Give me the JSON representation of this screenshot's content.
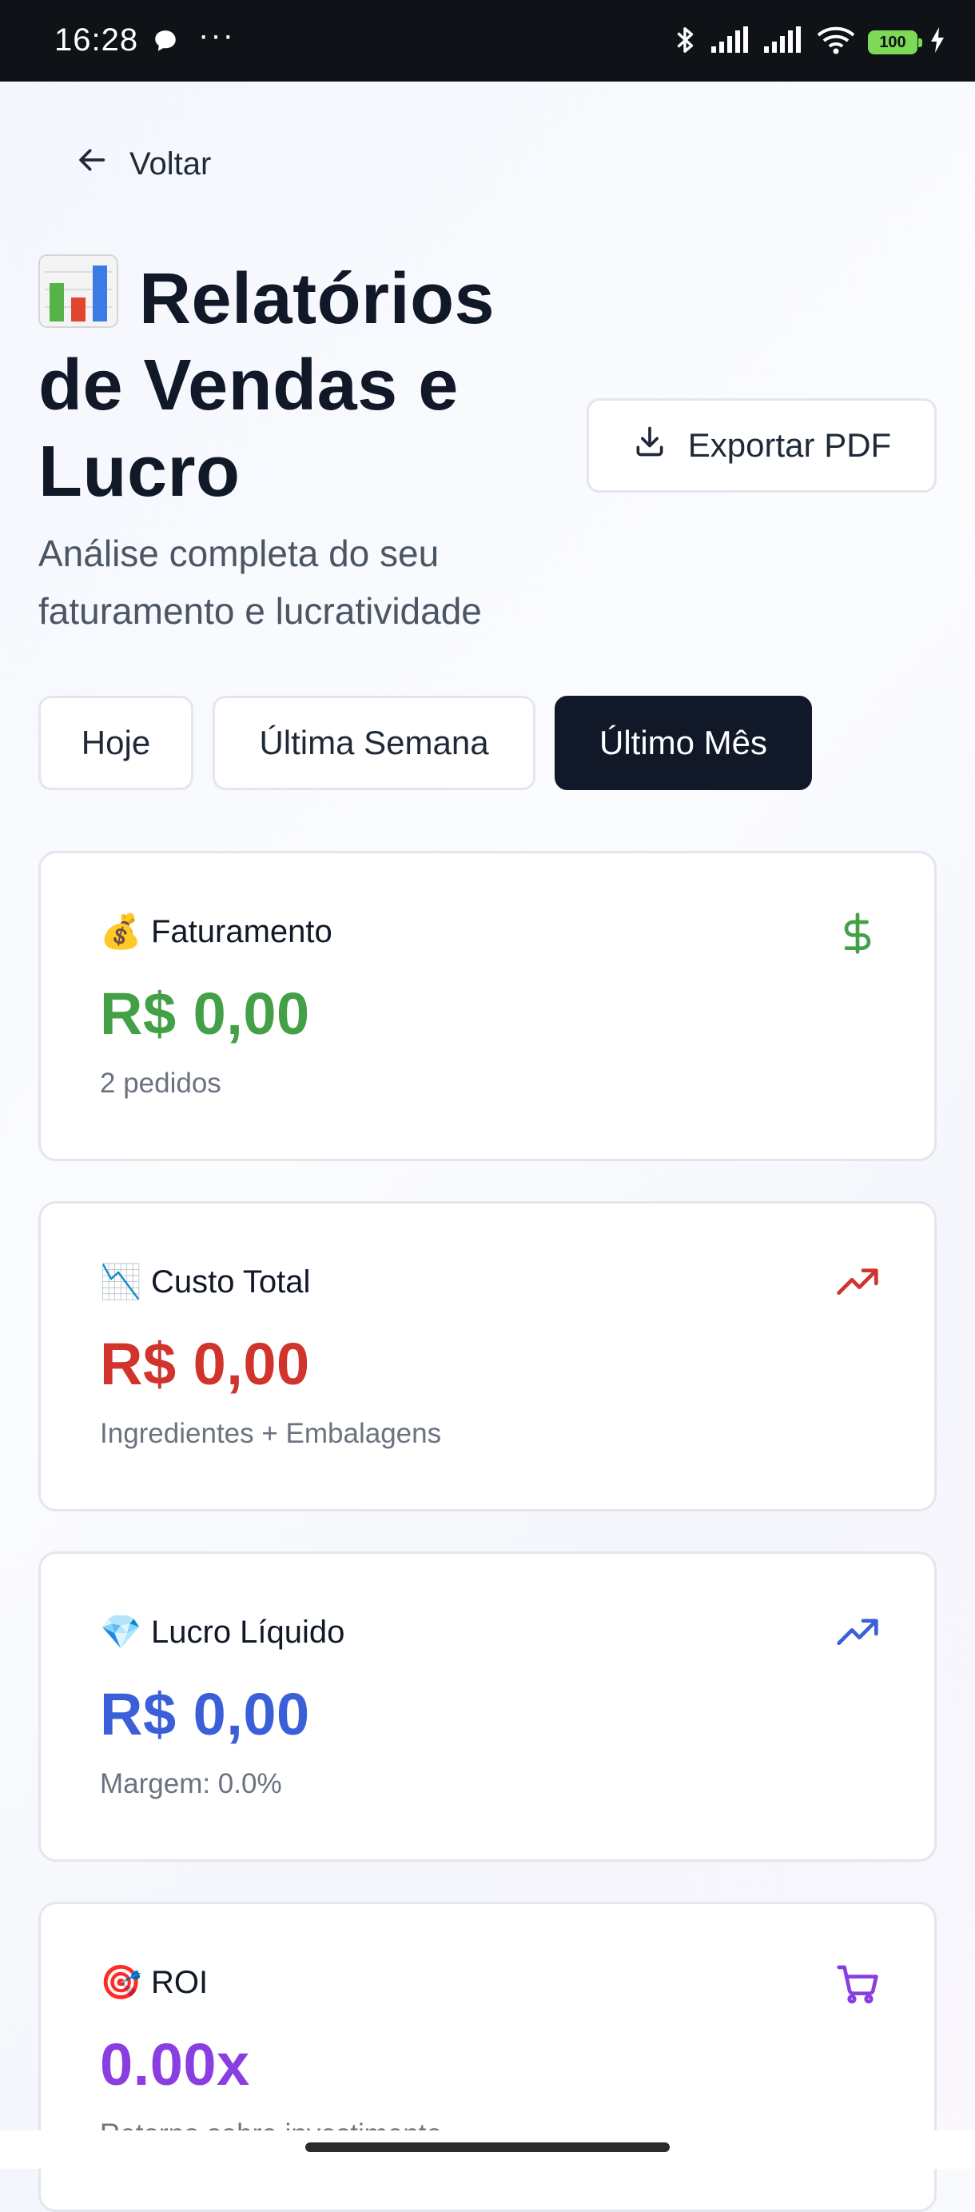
{
  "status_bar": {
    "time": "16:28",
    "dots": "···",
    "battery": "100",
    "icons": [
      "chat-bubble-icon",
      "bluetooth-icon",
      "signal-icon",
      "signal-icon",
      "wifi-icon",
      "battery-icon",
      "charging-icon"
    ]
  },
  "back": {
    "label": "Voltar",
    "icon": "arrow-left-icon"
  },
  "header": {
    "title": "Relatórios de Vendas e Lucro",
    "title_emoji": "bar-chart-icon",
    "subtitle": "Análise completa do seu faturamento e lucratividade",
    "export_label": "Exportar PDF",
    "export_icon": "download-icon"
  },
  "filters": {
    "items": [
      {
        "label": "Hoje",
        "active": false
      },
      {
        "label": "Última Semana",
        "active": false
      },
      {
        "label": "Último Mês",
        "active": true
      }
    ]
  },
  "cards": [
    {
      "emoji": "💰",
      "label": "Faturamento",
      "value": "R$ 0,00",
      "sub": "2 pedidos",
      "icon": "dollar-icon",
      "color": "#43a047"
    },
    {
      "emoji": "📉",
      "label": "Custo Total",
      "value": "R$ 0,00",
      "sub": "Ingredientes + Embalagens",
      "icon": "trending-up-icon",
      "color": "#d0342c"
    },
    {
      "emoji": "💎",
      "label": "Lucro Líquido",
      "value": "R$ 0,00",
      "sub": "Margem: 0.0%",
      "icon": "trending-up-icon",
      "color": "#3b5fd9"
    },
    {
      "emoji": "🎯",
      "label": "ROI",
      "value": "0.00x",
      "sub": "Retorno sobre investimento",
      "icon": "shopping-cart-icon",
      "color": "#8a3de0"
    }
  ],
  "colors": {
    "active_tab": "#111827",
    "background": "#f5f7fc"
  }
}
